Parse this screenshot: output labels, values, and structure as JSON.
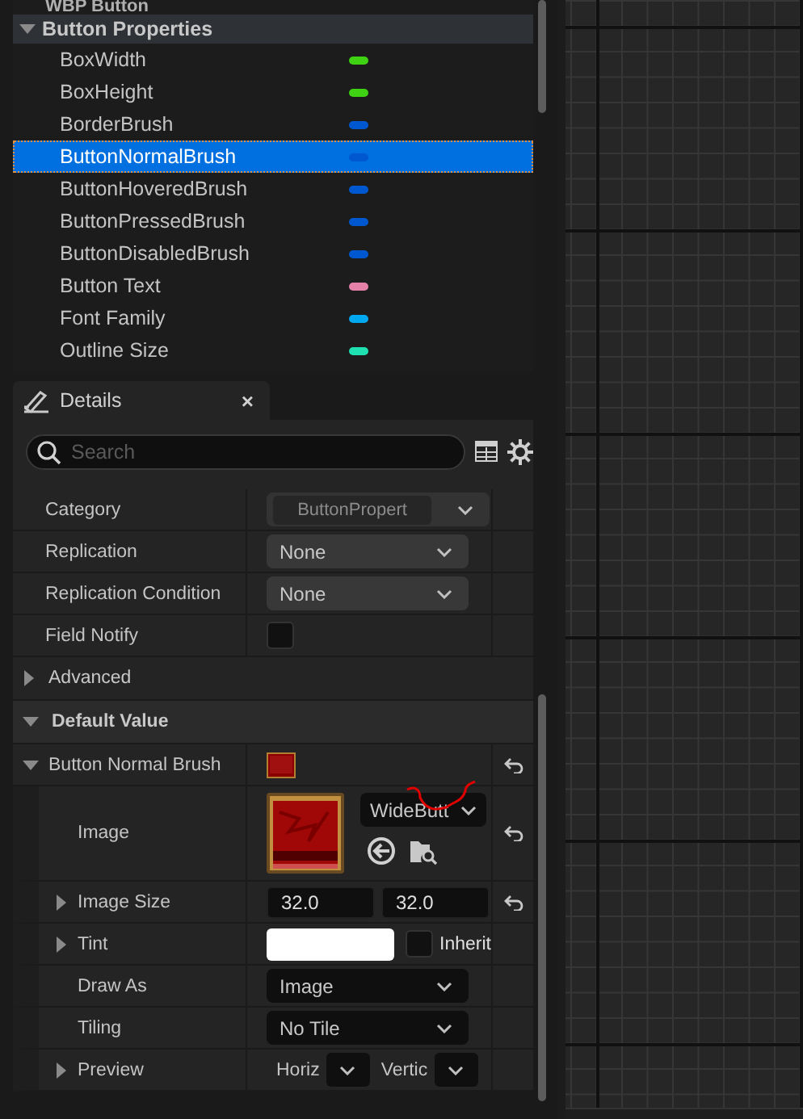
{
  "blueprint_panel": {
    "cut_item": "WBP Button",
    "category": {
      "label": "Button Properties",
      "expanded": true
    },
    "variables": [
      {
        "name": "BoxWidth",
        "color": "#3fd212",
        "selected": false
      },
      {
        "name": "BoxHeight",
        "color": "#3fd212",
        "selected": false
      },
      {
        "name": "BorderBrush",
        "color": "#0058d0",
        "selected": false
      },
      {
        "name": "ButtonNormalBrush",
        "color": "#0058d0",
        "selected": true
      },
      {
        "name": "ButtonHoveredBrush",
        "color": "#0058d0",
        "selected": false
      },
      {
        "name": "ButtonPressedBrush",
        "color": "#0058d0",
        "selected": false
      },
      {
        "name": "ButtonDisabledBrush",
        "color": "#0058d0",
        "selected": false
      },
      {
        "name": "Button Text",
        "color": "#e481a8",
        "selected": false
      },
      {
        "name": "Font Family",
        "color": "#00a8f0",
        "selected": false
      },
      {
        "name": "Outline Size",
        "color": "#1fe0b0",
        "selected": false
      }
    ]
  },
  "details_panel": {
    "tab": {
      "title": "Details",
      "close": "×"
    },
    "search": {
      "placeholder": "Search"
    },
    "rows": [
      {
        "kind": "combo",
        "label": "Category",
        "value": "ButtonPropert",
        "disabled": true
      },
      {
        "kind": "combo",
        "label": "Replication",
        "value": "None",
        "disabled": false
      },
      {
        "kind": "combo",
        "label": "Replication Condition",
        "value": "None",
        "disabled": false
      },
      {
        "kind": "checkbox",
        "label": "Field Notify",
        "checked": false
      },
      {
        "kind": "section",
        "label": "Advanced",
        "expanded": false
      },
      {
        "kind": "header",
        "label": "Default Value",
        "expanded": true,
        "children": [
          {
            "kind": "brush",
            "label": "Button Normal Brush",
            "expanded": true,
            "reset": true,
            "children": [
              {
                "kind": "image",
                "label": "Image",
                "asset": "WideButt",
                "reset": true
              },
              {
                "kind": "vector",
                "label": "Image Size",
                "expanded": false,
                "values": [
                  "32.0",
                  "32.0"
                ],
                "reset": true
              },
              {
                "kind": "tint",
                "label": "Tint",
                "expanded": false,
                "color": "#ffffff",
                "check_label": "Inherit",
                "checked": false
              },
              {
                "kind": "combo",
                "label": "Draw As",
                "value": "Image",
                "disabled": false
              },
              {
                "kind": "combo",
                "label": "Tiling",
                "value": "No Tile",
                "disabled": false
              },
              {
                "kind": "preview",
                "label": "Preview",
                "expanded": false,
                "fields": [
                  {
                    "label": "Horiz"
                  },
                  {
                    "label": "Vertic"
                  }
                ]
              }
            ]
          }
        ]
      }
    ]
  }
}
